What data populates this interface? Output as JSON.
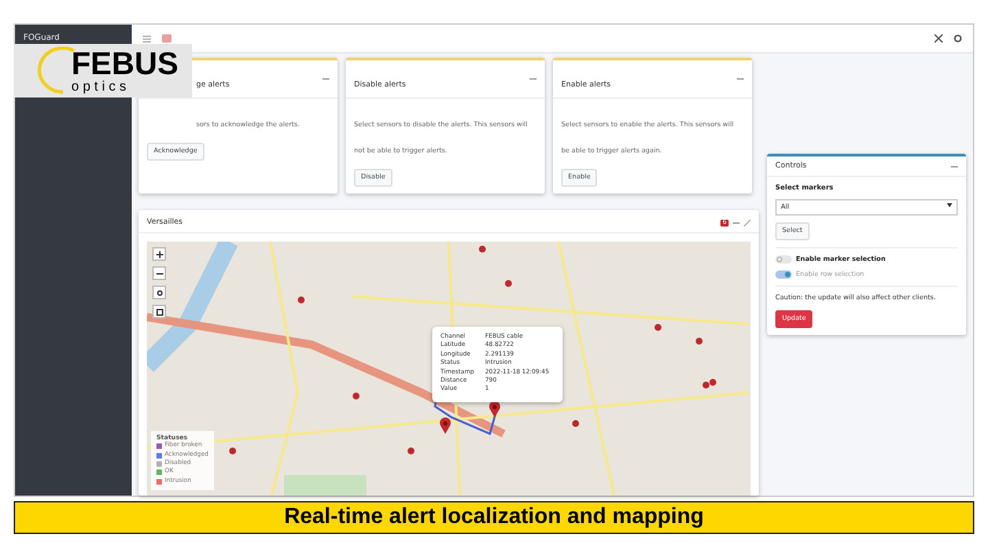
{
  "logo": {
    "brand": "FEBUS",
    "sub": "o p t i c s"
  },
  "sidebar": {
    "title": "FOGuard"
  },
  "cards": [
    {
      "title": "ge alerts",
      "text": "sors to acknowledge the alerts.",
      "button": "Acknowledge"
    },
    {
      "title": "Disable alerts",
      "text": "Select sensors to disable the alerts. This sensors will not be able to trigger alerts.",
      "button": "Disable"
    },
    {
      "title": "Enable alerts",
      "text": "Select sensors to enable the alerts. This sensors will be able to trigger alerts again.",
      "button": "Enable"
    }
  ],
  "map_panel": {
    "title": "Versailles",
    "badge": "6",
    "popup": [
      {
        "label": "Channel",
        "value": "FEBUS cable"
      },
      {
        "label": "Latitude",
        "value": "48.82722"
      },
      {
        "label": "Longitude",
        "value": "2.291139"
      },
      {
        "label": "Status",
        "value": "Intrusion"
      },
      {
        "label": "Timestamp",
        "value": "2022-11-18 12:09:45"
      },
      {
        "label": "Distance",
        "value": "790"
      },
      {
        "label": "Value",
        "value": "1"
      }
    ],
    "legend": {
      "title": "Statuses",
      "items": [
        {
          "label": "Fiber broken",
          "color": "#9b59b6"
        },
        {
          "label": "Acknowledged",
          "color": "#5b7cf0"
        },
        {
          "label": "Disabled",
          "color": "#b0b0b0"
        },
        {
          "label": "OK",
          "color": "#5cb85c"
        },
        {
          "label": "Intrusion",
          "color": "#f06a6a"
        }
      ]
    }
  },
  "controls": {
    "title": "Controls",
    "select_label": "Select markers",
    "select_value": "All",
    "select_button": "Select",
    "toggles": [
      {
        "label": "Enable marker selection",
        "on": false,
        "disabled": false
      },
      {
        "label": "Enable row selection",
        "on": true,
        "disabled": true
      }
    ],
    "caution": "Caution: the update will also affect other clients.",
    "update_button": "Update"
  },
  "caption": "Real-time alert localization and mapping"
}
